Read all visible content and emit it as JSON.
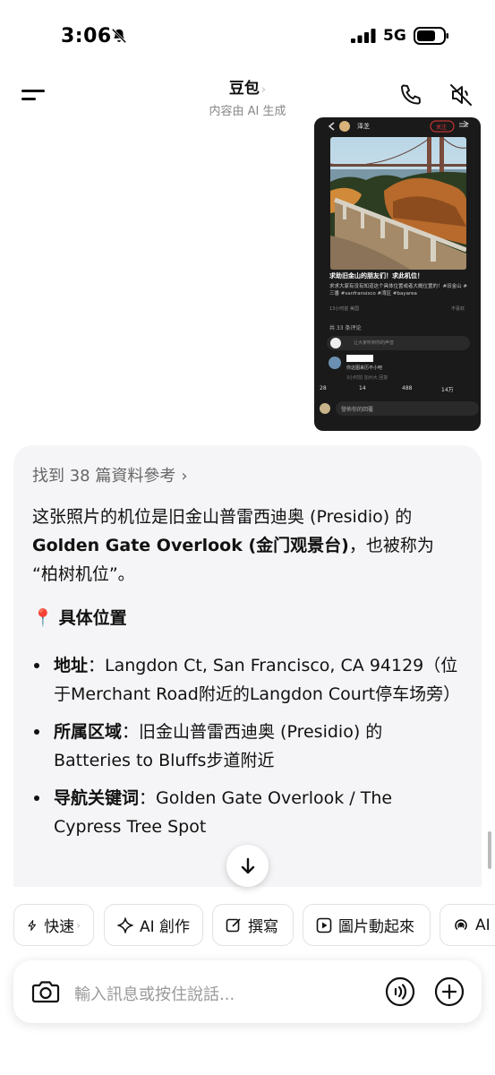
{
  "status_bar": {
    "time": "3:06",
    "network": "5G"
  },
  "header": {
    "title": "豆包",
    "title_chevron": "›",
    "subtitle": "内容由 AI 生成"
  },
  "image_message": {
    "username": "泽芝",
    "follow_label": "关注",
    "post_title": "求助旧金山的朋友们！求此机位！",
    "post_desc": "求求大家有没有知道这个具体位置或者大概位置的！#旧金山 #三番 #sanfransisco #湾区 #bayarea",
    "post_time": "13小时前 美国",
    "reply_label": "不喜欢",
    "comment_count": "共 33 条评论",
    "comment_placeholder": "让大家听到你的声音",
    "comment_text": "你这图来历不小吧",
    "comment_meta": "3小时前 加州大 回复",
    "stats": [
      "28",
      "14",
      "488",
      "14万",
      "41",
      "24",
      "33"
    ],
    "reply_input": "發佈你的回覆"
  },
  "answer": {
    "refs_label": "找到 38 篇資料參考",
    "intro_1": "这张照片的机位是旧金山普雷西迪奥 (Presidio) 的",
    "intro_bold": "Golden Gate Overlook (金门观景台)",
    "intro_2": "，也被称为",
    "intro_3": "“柏树机位”。",
    "section_title": "具体位置",
    "bullets": [
      {
        "label": "地址",
        "text": "：Langdon Ct, San Francisco, CA 94129（位于Merchant Road附近的Langdon Court停车场旁）"
      },
      {
        "label": "所属区域",
        "text": "：旧金山普雷西迪奥 (Presidio) 的 Batteries to Bluffs步道附近"
      },
      {
        "label": "导航关键词",
        "text": "：Golden Gate Overlook / The Cypress Tree Spot"
      }
    ]
  },
  "chips": [
    {
      "label": "快速",
      "icon": "lightning-icon"
    },
    {
      "label": "AI 創作",
      "icon": "sparkle-icon"
    },
    {
      "label": "撰寫",
      "icon": "pencil-square-icon"
    },
    {
      "label": "圖片動起來",
      "icon": "play-square-icon"
    },
    {
      "label": "AI",
      "icon": "podcast-icon"
    }
  ],
  "input": {
    "placeholder": "輸入訊息或按住說話..."
  },
  "colors": {
    "accent_red": "#e53935",
    "bubble_bg": "#f5f5f7"
  }
}
